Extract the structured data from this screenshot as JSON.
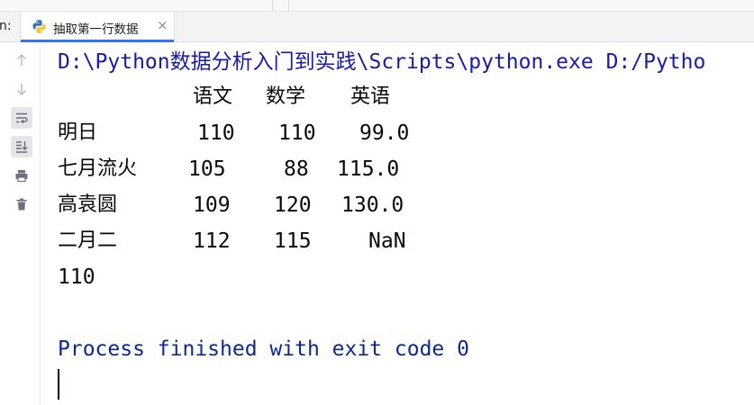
{
  "tab": {
    "run_label": "n:",
    "title": "抽取第一行数据",
    "close": "×",
    "icon": "python-icon"
  },
  "gutter": {
    "buttons": [
      {
        "icon": "arrow-up-icon"
      },
      {
        "icon": "arrow-down-icon"
      },
      {
        "icon": "soft-wrap-icon"
      },
      {
        "icon": "scroll-to-end-icon"
      },
      {
        "icon": "print-icon"
      },
      {
        "icon": "trash-icon"
      }
    ]
  },
  "console": {
    "command": "D:\\Python数据分析入门到实践\\Scripts\\python.exe D:/Pytho",
    "header": [
      "语文",
      "数学",
      "英语"
    ],
    "rows": [
      {
        "index": "明日",
        "values": [
          "110",
          "110",
          "99.0"
        ]
      },
      {
        "index": "七月流火",
        "values": [
          "105",
          "88",
          "115.0"
        ]
      },
      {
        "index": "高袁圆",
        "values": [
          "109",
          "120",
          "130.0"
        ]
      },
      {
        "index": "二月二",
        "values": [
          "112",
          "115",
          "NaN"
        ]
      }
    ],
    "result": "110",
    "exit_message": "Process finished with exit code 0"
  },
  "colors": {
    "accent": "#3574f0",
    "exit_text": "#0b2a8c"
  }
}
